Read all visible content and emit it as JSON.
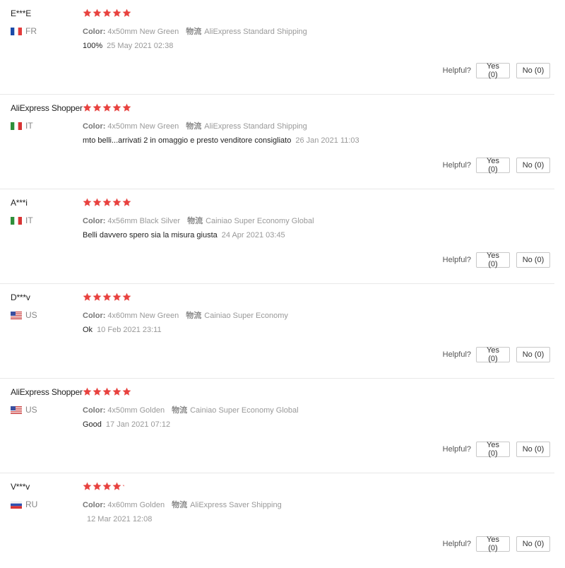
{
  "colors": {
    "star": "#e8423f",
    "text": "#222222",
    "muted": "#999999",
    "border": "#c8c8c8"
  },
  "labels": {
    "color_label": "Color:",
    "shipping_label": "物流",
    "helpful": "Helpful?"
  },
  "reviews": [
    {
      "user": "E***E",
      "country": "FR",
      "flag_icon": "france-flag-icon",
      "stars": 5,
      "color": "4x50mm New Green",
      "shipping": "AliExpress Standard Shipping",
      "text": "100%",
      "date": "25 May 2021 02:38",
      "yes": "Yes (0)",
      "no": "No (0)"
    },
    {
      "user": "AliExpress Shopper",
      "country": "IT",
      "flag_icon": "italy-flag-icon",
      "stars": 5,
      "color": "4x50mm New Green",
      "shipping": "AliExpress Standard Shipping",
      "text": "mto belli...arrivati 2 in omaggio e presto venditore consigliato",
      "date": "26 Jan 2021 11:03",
      "yes": "Yes (0)",
      "no": "No (0)"
    },
    {
      "user": "A***i",
      "country": "IT",
      "flag_icon": "italy-flag-icon",
      "stars": 5,
      "color": "4x56mm Black Silver",
      "shipping": "Cainiao Super Economy Global",
      "text": "Belli davvero spero sia la misura giusta",
      "date": "24 Apr 2021 03:45",
      "yes": "Yes (0)",
      "no": "No (0)"
    },
    {
      "user": "D***v",
      "country": "US",
      "flag_icon": "usa-flag-icon",
      "stars": 5,
      "color": "4x60mm New Green",
      "shipping": "Cainiao Super Economy",
      "text": "Ok",
      "date": "10 Feb 2021 23:11",
      "yes": "Yes (0)",
      "no": "No (0)"
    },
    {
      "user": "AliExpress Shopper",
      "country": "US",
      "flag_icon": "usa-flag-icon",
      "stars": 5,
      "color": "4x50mm Golden",
      "shipping": "Cainiao Super Economy Global",
      "text": "Good",
      "date": "17 Jan 2021 07:12",
      "yes": "Yes (0)",
      "no": "No (0)"
    },
    {
      "user": "V***v",
      "country": "RU",
      "flag_icon": "russia-flag-icon",
      "stars": 4.2,
      "color": "4x60mm Golden",
      "shipping": "AliExpress Saver Shipping",
      "text": "",
      "date": "12 Mar 2021 12:08",
      "yes": "Yes (0)",
      "no": "No (0)"
    }
  ]
}
